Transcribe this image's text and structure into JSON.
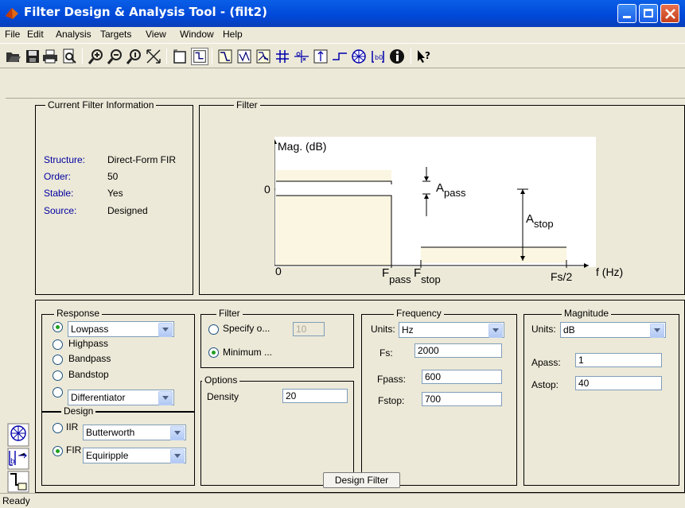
{
  "window": {
    "title": "Filter Design & Analysis Tool -  (filt2)"
  },
  "menu": [
    "File",
    "Edit",
    "Analysis",
    "Targets",
    "View",
    "Window",
    "Help"
  ],
  "info": {
    "legend": "Current Filter Information",
    "structure_label": "Structure:",
    "structure": "Direct-Form FIR",
    "order_label": "Order:",
    "order": "50",
    "stable_label": "Stable:",
    "stable": "Yes",
    "source_label": "Source:",
    "source": "Designed"
  },
  "filter_panel": {
    "legend": "Filter",
    "mag_label": "Mag. (dB)",
    "zero_y": "0",
    "zero_x": "0",
    "apass": "A",
    "apass_sub": "pass",
    "astop": "A",
    "astop_sub": "stop",
    "fpass": "F",
    "fpass_sub": "pass",
    "fstop": "F",
    "fstop_sub": "stop",
    "fs2": "Fs/2",
    "fhz": "f (Hz)"
  },
  "response": {
    "legend": "Response",
    "options": [
      "Lowpass",
      "Highpass",
      "Bandpass",
      "Bandstop",
      "Differentiator"
    ],
    "selected": "Lowpass"
  },
  "design": {
    "legend": "Design",
    "iir_label": "IIR",
    "iir_value": "Butterworth",
    "fir_label": "FIR",
    "fir_value": "Equiripple",
    "selected": "FIR"
  },
  "filter_order": {
    "legend": "Filter",
    "specify_label": "Specify o...",
    "specify_value": "10",
    "minimum_label": "Minimum ...",
    "selected": "Minimum"
  },
  "options": {
    "legend": "Options",
    "density_label": "Density",
    "density_value": "20"
  },
  "frequency": {
    "legend": "Frequency",
    "units_label": "Units:",
    "units": "Hz",
    "fs_label": "Fs:",
    "fs": "2000",
    "fpass_label": "Fpass:",
    "fpass": "600",
    "fstop_label": "Fstop:",
    "fstop": "700"
  },
  "magnitude": {
    "legend": "Magnitude",
    "units_label": "Units:",
    "units": "dB",
    "apass_label": "Apass:",
    "apass": "1",
    "astop_label": "Astop:",
    "astop": "40"
  },
  "design_button": "Design Filter",
  "status": "Ready"
}
